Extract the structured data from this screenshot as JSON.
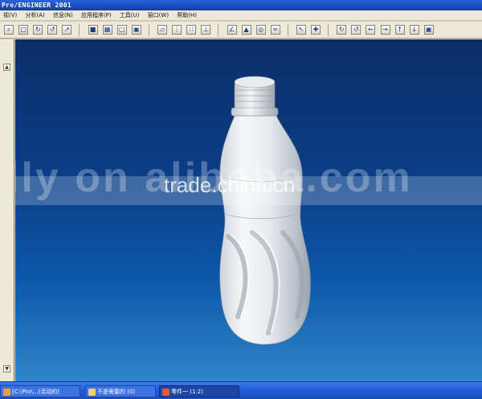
{
  "window": {
    "title": "Pro/ENGINEER 2001"
  },
  "menubar": {
    "items": [
      "视(V)",
      "分析(A)",
      "信息(N)",
      "应用程序(P)",
      "工具(U)",
      "窗口(W)",
      "帮助(H)"
    ]
  },
  "toolbar": {
    "groups": [
      [
        "zoom-icon",
        "zoom-fit-icon",
        "repaint-icon",
        "spin-icon",
        "orient-icon"
      ],
      [
        "shade-icon",
        "hidden-line-icon",
        "no-hidden-icon",
        "wireframe-icon"
      ],
      [
        "datum-plane-icon",
        "datum-axis-icon",
        "datum-point-icon",
        "csys-icon"
      ],
      [
        "sketch-icon",
        "extrude-icon",
        "revolve-icon",
        "sweep-icon"
      ],
      [
        "select-icon",
        "pick-icon"
      ],
      [
        "view-front-icon",
        "view-back-icon",
        "view-left-icon",
        "view-right-icon",
        "view-top-icon",
        "view-bottom-icon",
        "view-default-icon"
      ]
    ]
  },
  "watermark": {
    "large": "lly on alibaba.com",
    "small": "trade.china.cn"
  },
  "taskbar": {
    "tasks": [
      {
        "label": "[C:\\Pro\\...(活动的)",
        "icon": "proe-icon"
      },
      {
        "label": "不是需要的 (0)",
        "icon": "folder-icon"
      },
      {
        "label": "零件一 (1:2)",
        "icon": "part-icon"
      }
    ]
  },
  "colors": {
    "viewport_top": "#0b2f67",
    "viewport_bottom": "#2f86c9",
    "titlebar": "#1c4fc0"
  }
}
